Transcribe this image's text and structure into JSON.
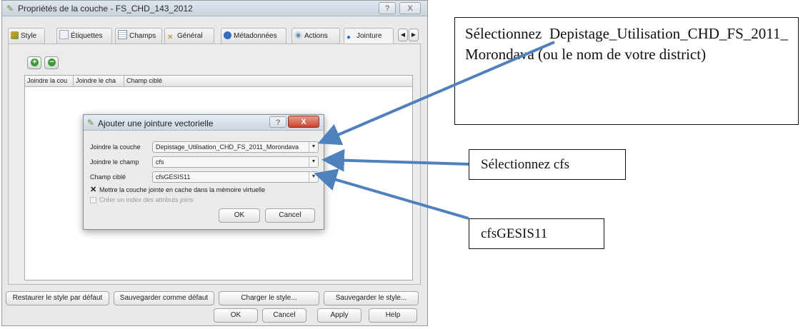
{
  "window": {
    "title": "Propriétés de la couche - FS_CHD_143_2012",
    "help_symbol": "?",
    "close_symbol": "X"
  },
  "tabs": [
    {
      "label": "Style"
    },
    {
      "label": "Étiquettes"
    },
    {
      "label": "Champs"
    },
    {
      "label": "Général"
    },
    {
      "label": "Métadonnées"
    },
    {
      "label": "Actions"
    },
    {
      "label": "Jointure"
    }
  ],
  "tab_scroll": {
    "left": "◀",
    "right": "▶"
  },
  "joins_table": {
    "add_symbol": "+",
    "remove_symbol": "−",
    "columns": [
      "Joindre la cou",
      "Joindre le cha",
      "Champ ciblé"
    ]
  },
  "style_buttons": {
    "restore": "Restaurer le style par défaut",
    "save_default": "Sauvegarder comme défaut",
    "load": "Charger le style...",
    "save_as": "Sauvegarder le style..."
  },
  "footer_buttons": {
    "ok": "OK",
    "cancel": "Cancel",
    "apply": "Apply",
    "help": "Help"
  },
  "dialog": {
    "title": "Ajouter une jointure vectorielle",
    "help_symbol": "?",
    "close_symbol": "X",
    "join_layer_label": "Joindre la couche",
    "join_layer_value": "Depistage_Utilisation_CHD_FS_2011_Morondava",
    "join_field_label": "Joindre le champ",
    "join_field_value": "cfs",
    "target_field_label": "Champ ciblé",
    "target_field_value": "cfsGESIS11",
    "cache_label": "Mettre la couche jointe en cache dans la mémoire virtuelle",
    "cache_checked": true,
    "index_label": "Créer un index des attributs joins",
    "index_checked": false,
    "ok": "OK",
    "cancel": "Cancel"
  },
  "callouts": {
    "layer": "Sélectionnez Depistage_Utilisation_CHD_FS_2011_Morondava (ou le nom de votre district)",
    "field": "Sélectionnez cfs",
    "target": "cfsGESIS11"
  },
  "colors": {
    "arrow": "#4f81bd",
    "dialog_close": "#c9462f"
  }
}
